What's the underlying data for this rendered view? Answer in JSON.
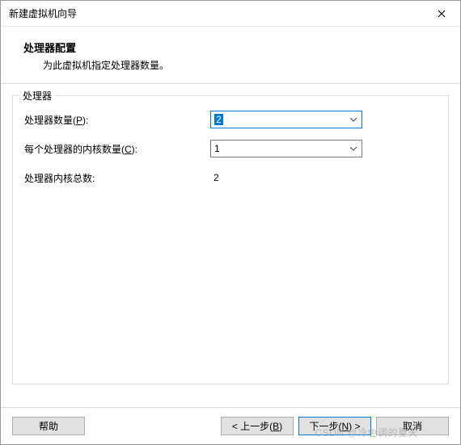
{
  "window": {
    "title": "新建虚拟机向导"
  },
  "header": {
    "title": "处理器配置",
    "subtitle": "为此虚拟机指定处理器数量。"
  },
  "group": {
    "title": "处理器",
    "proc_count_label_pre": "处理器数量(",
    "proc_count_hotkey": "P",
    "proc_count_label_post": "):",
    "proc_count_value": "2",
    "cores_label_pre": "每个处理器的内核数量(",
    "cores_hotkey": "C",
    "cores_label_post": "):",
    "cores_value": "1",
    "total_label": "处理器内核总数:",
    "total_value": "2"
  },
  "buttons": {
    "help": "帮助",
    "back_pre": "< 上一步(",
    "back_hotkey": "B",
    "back_post": ")",
    "next_pre": "下一步(",
    "next_hotkey": "N",
    "next_post": ") >",
    "cancel": "取消"
  },
  "watermark": "CSDN @冷色调的夏天"
}
